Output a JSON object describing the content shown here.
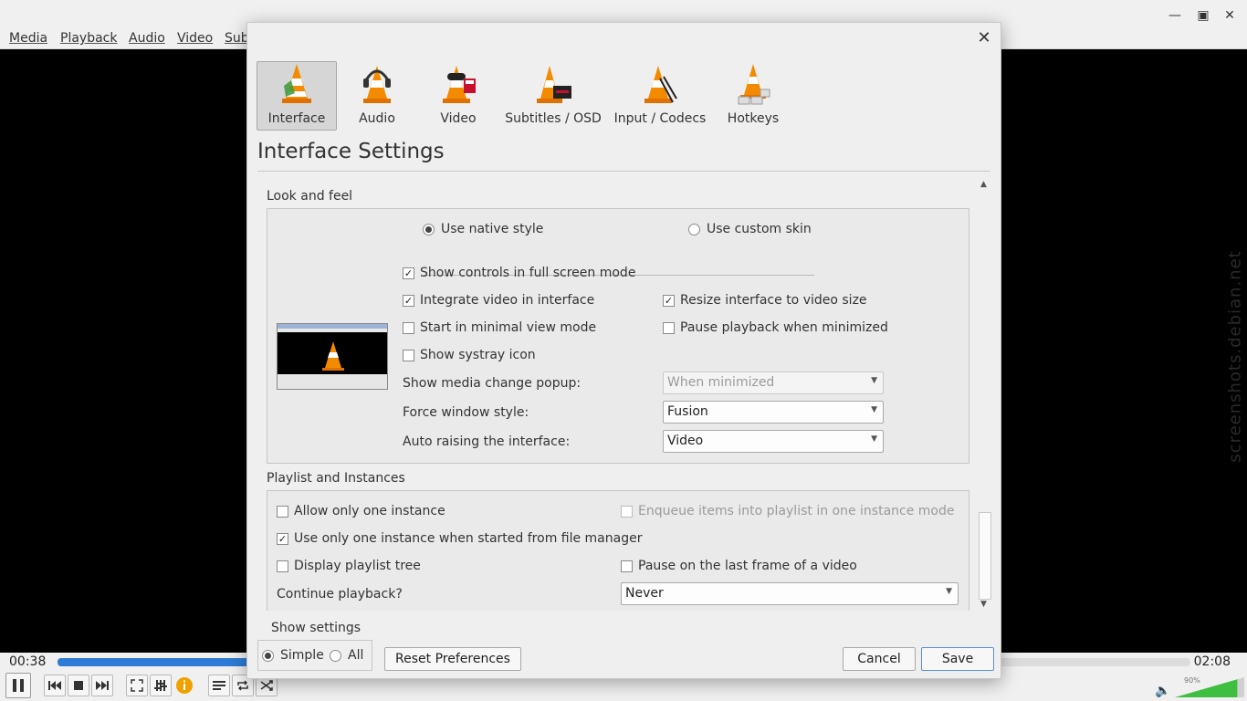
{
  "menubar": {
    "items": [
      "Media",
      "Playback",
      "Audio",
      "Video",
      "Sub"
    ]
  },
  "window_controls": {
    "minimize": "—",
    "maximize": "▣",
    "close": "✕"
  },
  "watermark": "screenshots.debian.net",
  "player": {
    "elapsed": "00:38",
    "total": "02:08",
    "progress": 0.3,
    "volume_pct": "90%",
    "volume_level": 0.9
  },
  "prefs": {
    "close_glyph": "✕",
    "categories": [
      {
        "label": "Interface",
        "icon": "interface-cone-icon",
        "selected": true
      },
      {
        "label": "Audio",
        "icon": "audio-cone-icon",
        "selected": false
      },
      {
        "label": "Video",
        "icon": "video-cone-icon",
        "selected": false
      },
      {
        "label": "Subtitles / OSD",
        "icon": "subtitles-cone-icon",
        "selected": false
      },
      {
        "label": "Input / Codecs",
        "icon": "codecs-cone-icon",
        "selected": false
      },
      {
        "label": "Hotkeys",
        "icon": "hotkeys-cone-icon",
        "selected": false
      }
    ],
    "title": "Interface Settings",
    "look_and_feel": {
      "title": "Look and feel",
      "native_style": "Use native style",
      "custom_skin": "Use custom skin",
      "show_controls_fullscreen": "Show controls in full screen mode",
      "integrate_video": "Integrate video in interface",
      "resize_interface": "Resize interface to video size",
      "start_minimal": "Start in minimal view mode",
      "pause_minimized": "Pause playback when minimized",
      "show_systray": "Show systray icon",
      "media_popup_label": "Show media change popup:",
      "media_popup_value": "When minimized",
      "window_style_label": "Force window style:",
      "window_style_value": "Fusion",
      "auto_raise_label": "Auto raising the interface:",
      "auto_raise_value": "Video"
    },
    "playlist": {
      "title": "Playlist and Instances",
      "one_instance": "Allow only one instance",
      "enqueue_items": "Enqueue items into playlist in one instance mode",
      "one_instance_fm": "Use only one instance when started from file manager",
      "playlist_tree": "Display playlist tree",
      "pause_last_frame": "Pause on the last frame of a video",
      "continue_label": "Continue playback?",
      "continue_value": "Never"
    },
    "show_settings": {
      "label": "Show settings",
      "simple": "Simple",
      "all": "All"
    },
    "buttons": {
      "reset": "Reset Preferences",
      "cancel": "Cancel",
      "save": "Save"
    }
  }
}
